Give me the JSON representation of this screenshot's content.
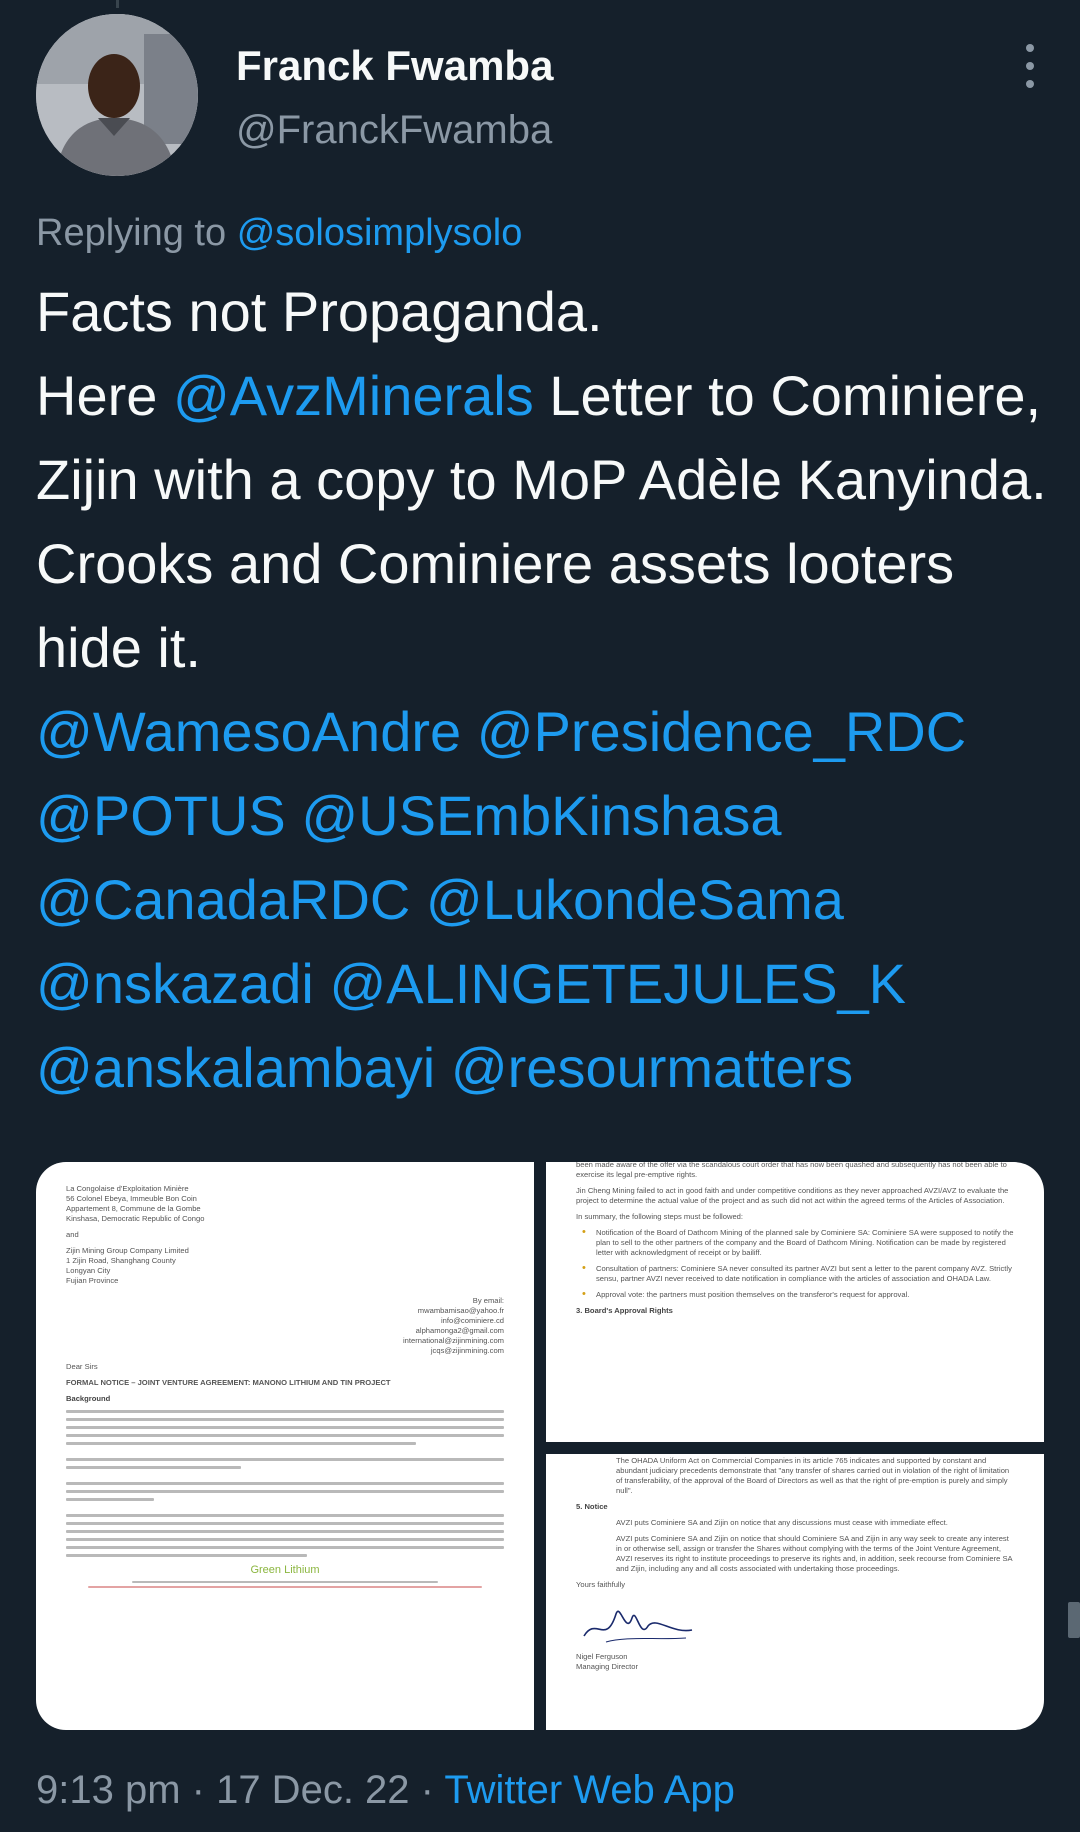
{
  "author": {
    "name": "Franck Fwamba",
    "handle": "@FranckFwamba"
  },
  "reply": {
    "prefix": "Replying to",
    "to": "@solosimplysolo"
  },
  "tweet": {
    "line1": "Facts not Propaganda.",
    "here": "Here ",
    "mention_avz": "@AvzMinerals",
    "body": " Letter to Cominiere, Zijin with a copy to MoP Adèle Kanyinda. Crooks and Cominiere assets looters hide it.",
    "mentions": [
      "@WamesoAndre",
      "@Presidence_RDC",
      "@POTUS",
      "@USEmbKinshasa",
      "@CanadaRDC",
      "@LukondeSama",
      "@nskazadi",
      "@ALINGETEJULES_K",
      "@anskalambayi",
      "@resourmatters"
    ]
  },
  "media": {
    "doc1": {
      "addr1": "La Congolaise d'Exploitation Minière\n56 Colonel Ebeya, Immeuble Bon Coin\nAppartement 8, Commune de la Gombe\nKinshasa, Democratic Republic of Congo",
      "and": "and",
      "addr2": "Zijin Mining Group Company Limited\n1 Zijin Road, Shanghang County\nLongyan City\nFujian Province",
      "by_email": "By email:",
      "emails": "mwambamisao@yahoo.fr\ninfo@cominiere.cd\nalphamonga2@gmail.com\ninternational@zijinmining.com\njcqs@zijinmining.com",
      "dear": "Dear Sirs",
      "subject": "FORMAL NOTICE – JOINT VENTURE AGREEMENT: MANONO LITHIUM AND TIN PROJECT",
      "background": "Background",
      "footer_logo": "Green Lithium"
    },
    "doc2": {
      "top": "been made aware of the offer via the scandalous court order that has now been quashed and subsequently has not been able to exercise its legal pre-emptive rights.",
      "para": "Jin Cheng Mining failed to act in good faith and under competitive conditions as they never approached AVZI/AVZ to evaluate the project to determine the actual value of the project and as such did not act within the agreed terms of the Articles of Association.",
      "summary": "In summary, the following steps must be followed:",
      "b1": "Notification of the Board of Dathcom Mining of the planned sale by Cominiere SA: Cominiere SA were supposed to notify the plan to sell to the other partners of the company and the Board of Dathcom Mining. Notification can be made by registered letter with acknowledgment of receipt or by bailiff.",
      "b2": "Consultation of partners: Cominiere SA never consulted its partner AVZI but sent a letter to the parent company AVZ. Strictly sensu, partner AVZI never received to date notification in compliance with the articles of association and OHADA Law.",
      "b3": "Approval vote: the partners must position themselves on the transferor's request for approval.",
      "heading": "3.     Board's Approval Rights"
    },
    "doc3": {
      "top": "The OHADA Uniform Act on Commercial Companies in its article 765 indicates and supported by constant and abundant judiciary precedents demonstrate that \"any transfer of shares carried out in violation of the right of limitation of transferability, of the approval of the Board of Directors as well as that the right of pre-emption is purely and simply null\".",
      "heading": "5.     Notice",
      "p1": "AVZI puts Cominiere SA and Zijin on notice that any discussions must cease with immediate effect.",
      "p2": "AVZI puts Cominiere SA and Zijin on notice that should Cominiere SA and Zijin in any way seek to create any interest in or otherwise sell, assign or transfer the Shares without complying with the terms of the Joint Venture Agreement, AVZI reserves its right to institute proceedings to preserve its rights and, in addition, seek recourse from Cominiere SA and Zijin, including any and all costs associated with undertaking those proceedings.",
      "closing": "Yours faithfully",
      "signer": "Nigel Ferguson",
      "signer_title": "Managing Director"
    }
  },
  "meta": {
    "time": "9:13 pm",
    "sep1": " · ",
    "date": "17 Dec. 22",
    "sep2": " · ",
    "app": "Twitter Web App"
  },
  "colors": {
    "background": "#15202b",
    "text": "#f7f9f9",
    "muted": "#8b98a5",
    "link": "#1d9bf0"
  },
  "icons": {
    "more": "more-vertical-icon",
    "avatar": "user-avatar"
  }
}
